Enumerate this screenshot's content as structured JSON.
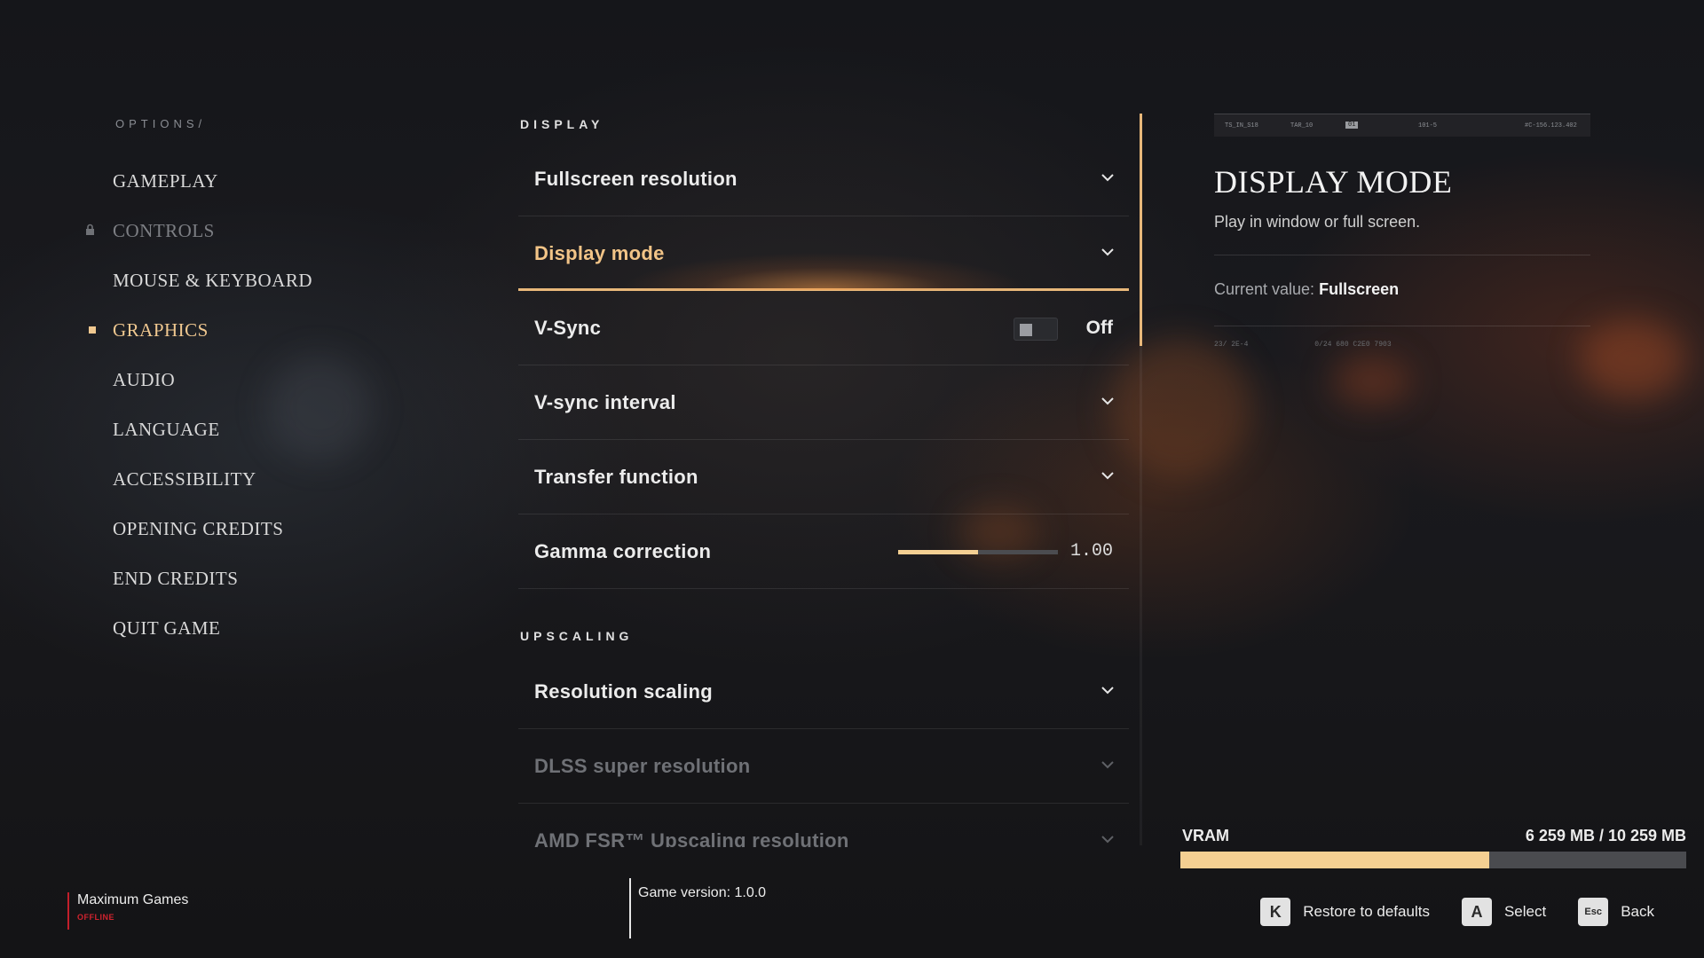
{
  "nav": {
    "breadcrumb": "OPTIONS/",
    "items": [
      {
        "label": "GAMEPLAY"
      },
      {
        "label": "CONTROLS"
      },
      {
        "label": "MOUSE & KEYBOARD"
      },
      {
        "label": "GRAPHICS"
      },
      {
        "label": "AUDIO"
      },
      {
        "label": "LANGUAGE"
      },
      {
        "label": "ACCESSIBILITY"
      },
      {
        "label": "OPENING CREDITS"
      },
      {
        "label": "END CREDITS"
      },
      {
        "label": "QUIT GAME"
      }
    ],
    "locked_item": "CONTROLS",
    "active_item": "GRAPHICS"
  },
  "settings": {
    "display_section": "DISPLAY",
    "upscaling_section": "UPSCALING",
    "fullscreen_resolution": "Fullscreen resolution",
    "display_mode": "Display mode",
    "vsync": {
      "label": "V-Sync",
      "value": "Off",
      "enabled": false
    },
    "vsync_interval": "V-sync interval",
    "transfer_function": "Transfer function",
    "gamma": {
      "label": "Gamma correction",
      "value": "1.00",
      "fill_fraction": 0.5
    },
    "resolution_scaling": "Resolution scaling",
    "dlss": "DLSS super resolution",
    "amd_fsr": "AMD FSR™ Upscaling resolution"
  },
  "info": {
    "strip": [
      "TS_IN_S18",
      "TAR_10",
      "01",
      "101-5",
      "#C-156.123.402"
    ],
    "title": "DISPLAY MODE",
    "description": "Play in window or full screen.",
    "current_prefix": "Current value:",
    "current_value": "Fullscreen",
    "micro": [
      "23/ 2E-4",
      "0/24 680 C2E0 7903"
    ]
  },
  "vram": {
    "label": "VRAM",
    "value": "6 259 MB / 10 259 MB",
    "used_fraction": 0.61
  },
  "footer": {
    "profile_name": "Maximum Games",
    "profile_status": "OFFLINE",
    "version": "Game version: 1.0.0",
    "hints": [
      {
        "key": "K",
        "label": "Restore to defaults"
      },
      {
        "key": "A",
        "label": "Select"
      },
      {
        "key": "Esc",
        "label": "Back"
      }
    ]
  },
  "colors": {
    "accent": "#f0c890",
    "highlight_glow": "#e8b87a",
    "offline_red": "#d0232e"
  }
}
